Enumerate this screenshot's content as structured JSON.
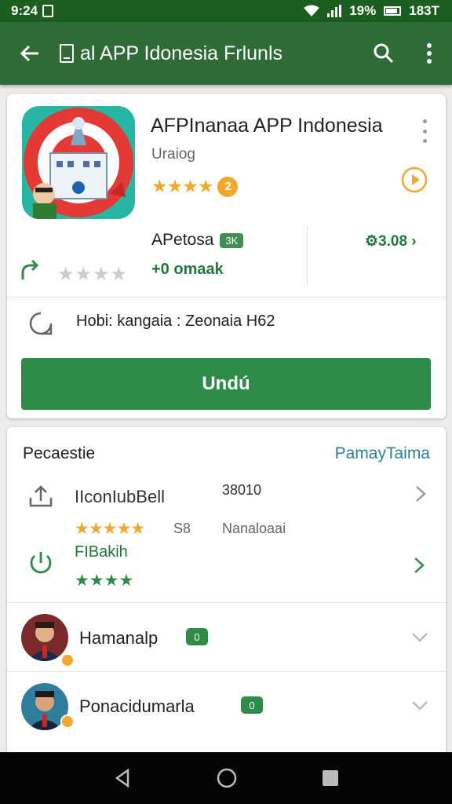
{
  "status_bar": {
    "time": "9:24",
    "battery": "19%",
    "clock": "183T"
  },
  "toolbar": {
    "title": "al APP Idonesia Frlunls"
  },
  "app": {
    "title": "AFPInanaa APP Indonesia",
    "developer": "Uraiog",
    "stars": "★★★★",
    "rating_badge": "2",
    "meta_name": "APetosa",
    "meta_chip": "3K",
    "meta_sub": "+0 omaak",
    "price": "3.08",
    "grey_stars": "★★★★",
    "info_text": "Hobi: kangaia : Zeonaia H62",
    "install_label": "Undú"
  },
  "section": {
    "title": "Pecaestie",
    "link": "PamayTaima",
    "row1": {
      "name": "IIconIubBell",
      "num": "38010",
      "stars": "★★★★★",
      "score": "S8",
      "sub": "Nanaloaai"
    },
    "row2": {
      "name": "FIBakih",
      "stars": "★★★★"
    },
    "person1": {
      "name": "Hamanalp",
      "chip": "0"
    },
    "person2": {
      "name": "Ponacidumarla",
      "chip": "0"
    }
  },
  "colors": {
    "primary": "#2e6b36",
    "install": "#2e8b48",
    "star": "#f2a72d",
    "link": "#2d7f9a"
  }
}
